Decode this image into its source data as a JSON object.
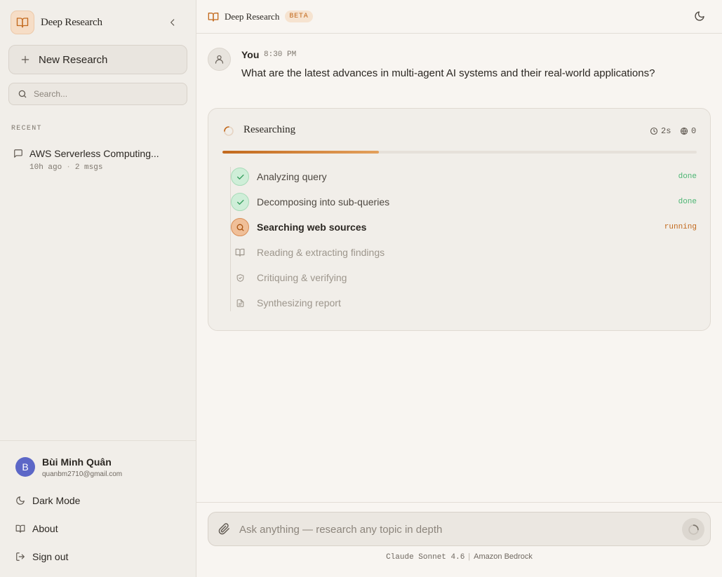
{
  "sidebar": {
    "brand": "Deep Research",
    "new_button": "New Research",
    "search_placeholder": "Search...",
    "recent_label": "RECENT",
    "conversations": [
      {
        "title": "AWS Serverless Computing...",
        "time": "10h ago",
        "msgs": "2 msgs"
      }
    ],
    "user": {
      "initial": "B",
      "name": "Bùi Minh Quân",
      "email": "quanbm2710@gmail.com"
    },
    "menu": {
      "dark_mode": "Dark Mode",
      "about": "About",
      "sign_out": "Sign out"
    }
  },
  "topbar": {
    "title": "Deep Research",
    "badge": "BETA"
  },
  "message": {
    "sender": "You",
    "time": "8:30 PM",
    "text": "What are the latest advances in multi-agent AI systems and their real-world applications?"
  },
  "research": {
    "title": "Researching",
    "elapsed": "2s",
    "sources": "0",
    "progress": 0.33,
    "steps": [
      {
        "label": "Analyzing query",
        "state": "done",
        "status": "done",
        "icon": "check-icon"
      },
      {
        "label": "Decomposing into sub-queries",
        "state": "done",
        "status": "done",
        "icon": "check-icon"
      },
      {
        "label": "Searching web sources",
        "state": "running",
        "status": "running",
        "icon": "search-icon"
      },
      {
        "label": "Reading & extracting findings",
        "state": "pending",
        "status": "",
        "icon": "book-icon"
      },
      {
        "label": "Critiquing & verifying",
        "state": "pending",
        "status": "",
        "icon": "shield-icon"
      },
      {
        "label": "Synthesizing report",
        "state": "pending",
        "status": "",
        "icon": "document-icon"
      }
    ]
  },
  "composer": {
    "placeholder": "Ask anything — research any topic in depth",
    "model": "Claude Sonnet 4.6",
    "provider": "Amazon Bedrock"
  },
  "colors": {
    "accent": "#c2691d",
    "done": "#4cb673",
    "avatar": "#5c67c7"
  }
}
